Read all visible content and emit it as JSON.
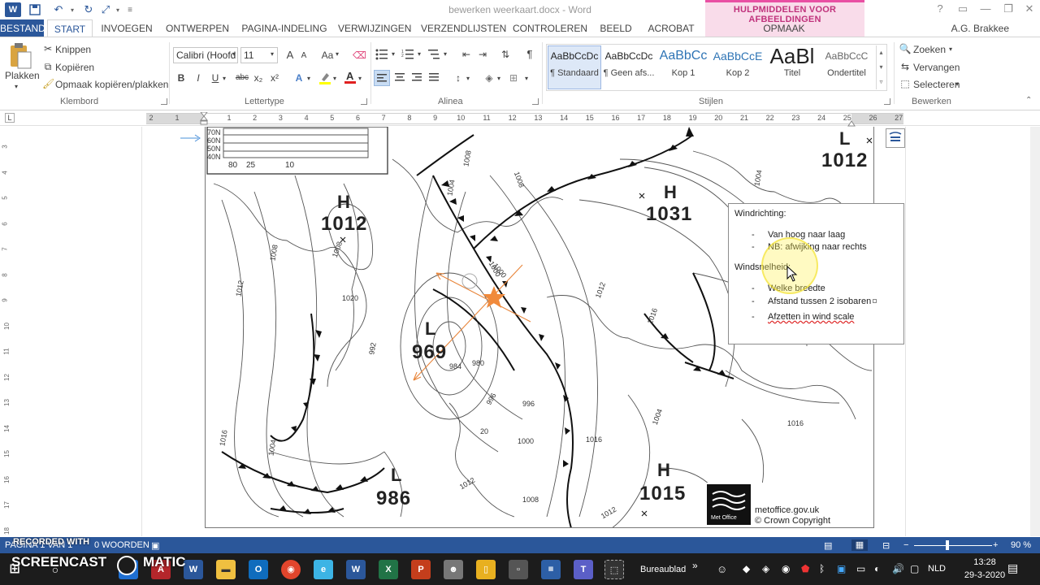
{
  "window": {
    "doc_title": "bewerken weerkaart.docx - Word",
    "context_tool_group": "HULPMIDDELEN VOOR AFBEELDINGEN",
    "context_tab": "OPMAAK",
    "user": "A.G. Brakkee",
    "help_glyph": "?"
  },
  "tabs": [
    "BESTAND",
    "START",
    "INVOEGEN",
    "ONTWERPEN",
    "PAGINA-INDELING",
    "VERWIJZINGEN",
    "VERZENDLIJSTEN",
    "CONTROLEREN",
    "BEELD",
    "ACROBAT"
  ],
  "ribbon": {
    "clipboard": {
      "paste": "Plakken",
      "cut": "Knippen",
      "copy": "Kopiëren",
      "format_painter": "Opmaak kopiëren/plakken",
      "group": "Klembord"
    },
    "font": {
      "name": "Calibri (Hoofd",
      "size": "11",
      "group": "Lettertype",
      "grow": "A",
      "shrink": "A",
      "case": "Aa",
      "bold": "B",
      "italic": "I",
      "underline": "U",
      "strike": "abc",
      "subscript": "x₂",
      "superscript": "x²"
    },
    "paragraph": {
      "group": "Alinea",
      "pilcrow": "¶"
    },
    "styles": {
      "group": "Stijlen",
      "items": [
        {
          "preview": "AaBbCcDc",
          "name": "¶ Standaard"
        },
        {
          "preview": "AaBbCcDc",
          "name": "¶ Geen afs..."
        },
        {
          "preview": "AaBbCc",
          "name": "Kop 1"
        },
        {
          "preview": "AaBbCcE",
          "name": "Kop 2"
        },
        {
          "preview": "AaBl",
          "name": "Titel"
        },
        {
          "preview": "AaBbCcC",
          "name": "Ondertitel"
        }
      ]
    },
    "editing": {
      "group": "Bewerken",
      "find": "Zoeken",
      "replace": "Vervangen",
      "select": "Selecteren"
    }
  },
  "ruler": {
    "numbers": [
      "2",
      "1",
      "1",
      "2",
      "3",
      "4",
      "5",
      "6",
      "7",
      "8",
      "9",
      "10",
      "11",
      "12",
      "13",
      "14",
      "15",
      "16",
      "17",
      "18",
      "19",
      "20",
      "21",
      "22",
      "23",
      "24",
      "25",
      "26",
      "27"
    ],
    "vertical": [
      "3",
      "4",
      "5",
      "6",
      "7",
      "8",
      "9",
      "10",
      "11",
      "12",
      "13",
      "14",
      "15",
      "16",
      "17",
      "18"
    ]
  },
  "map": {
    "scale_labels": {
      "lat_70": "70N",
      "lat_60": "60N",
      "lat_50": "50N",
      "lat_40": "40N",
      "s80": "80",
      "s25": "25",
      "s10": "10"
    },
    "pressure_systems": [
      {
        "letter": "H",
        "value": "1012"
      },
      {
        "letter": "H",
        "value": "1031"
      },
      {
        "letter": "L",
        "value": "969"
      },
      {
        "letter": "L",
        "value": "986"
      },
      {
        "letter": "H",
        "value": "1015"
      },
      {
        "letter": "L",
        "value": "1012"
      }
    ],
    "isobar_labels": [
      "1008",
      "1004",
      "1000",
      "1008",
      "1012",
      "1016",
      "1004",
      "996",
      "1008",
      "1012",
      "1016",
      "1020",
      "1004",
      "992",
      "996",
      "1000",
      "1004",
      "1008",
      "1012",
      "1016",
      "1016",
      "1008",
      "1012",
      "984",
      "980",
      "1000",
      "20"
    ],
    "credit_site": "metoffice.gov.uk",
    "credit_copyright": "© Crown Copyright",
    "logo_text": "Met Office"
  },
  "textbox": {
    "heading1": "Windrichting:",
    "items1": [
      "Van hoog naar laag",
      "NB: afwijking naar rechts"
    ],
    "heading2": "Windsnelheid:",
    "items2": [
      "Welke breedte",
      "Afstand tussen 2 isobaren",
      "Afzetten in wind scale"
    ],
    "dash": "-"
  },
  "status": {
    "page": "PAGINA 1 VAN 1",
    "words": "0 WOORDEN",
    "zoom": "90 %",
    "minus": "−",
    "plus": "+"
  },
  "watermark": {
    "line1": "RECORDED WITH",
    "line2": "SCREENCAST",
    "line3": "MATIC"
  },
  "taskbar": {
    "desktop": "Bureaublad",
    "lang": "NLD",
    "time": "13:28",
    "date": "29-3-2020"
  },
  "colors": {
    "word_blue": "#2b579a",
    "context_pink": "#e94fa3",
    "highlight_yellow": "#f5e033",
    "taskbar": "#1c1c1c"
  }
}
